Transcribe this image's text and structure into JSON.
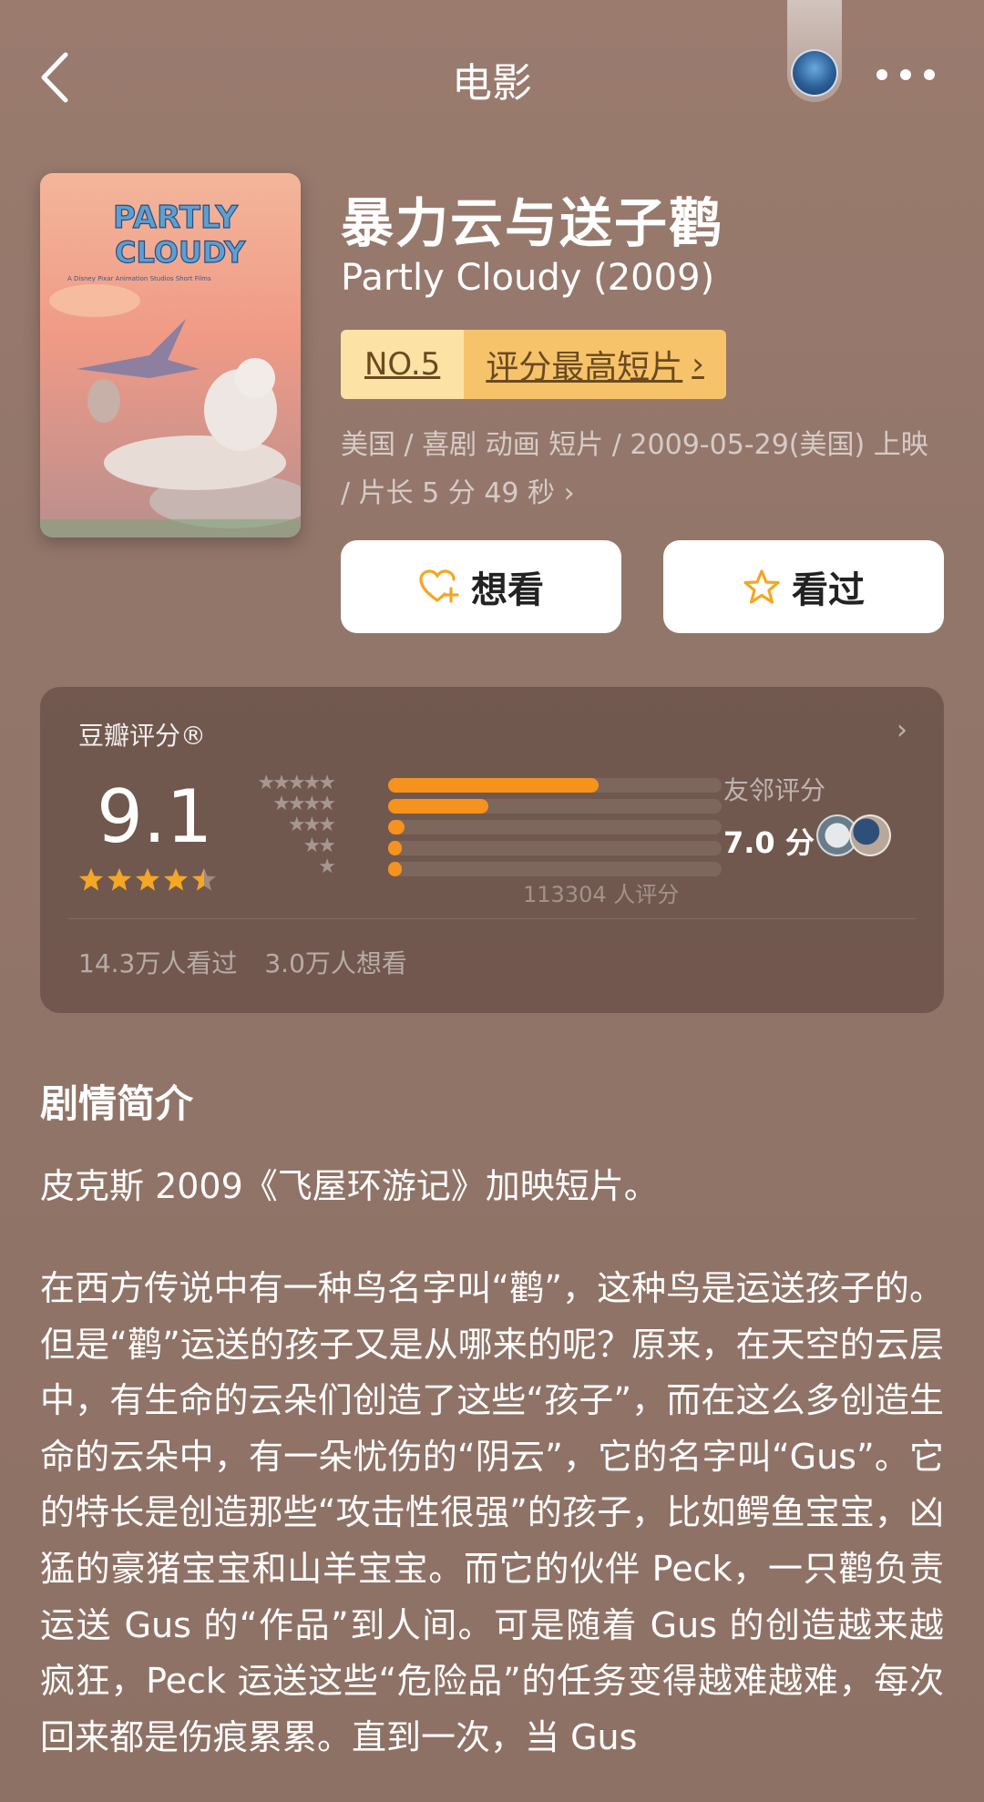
{
  "nav": {
    "title": "电影"
  },
  "movie": {
    "title_cn": "暴力云与送子鹳",
    "title_en": "Partly Cloudy (2009)",
    "rank_no": "NO.5",
    "rank_list": "评分最高短片",
    "meta": "美国 / 喜剧 动画 短片 / 2009-05-29(美国) 上映 / 片长 5 分 49 秒",
    "poster_text": {
      "line1": "PARTLY",
      "line2": "CLOUDY",
      "line3": "A Disney Pixar Animation Studios Short Films"
    }
  },
  "actions": {
    "want_label": "想看",
    "seen_label": "看过"
  },
  "rating": {
    "label": "豆瓣评分®",
    "score": "9.1",
    "stars_filled": 4.5,
    "histogram": [
      {
        "stars": "★★★★★",
        "pct": 63
      },
      {
        "stars": "★★★★",
        "pct": 30
      },
      {
        "stars": "★★★",
        "pct": 5
      },
      {
        "stars": "★★",
        "pct": 4
      },
      {
        "stars": "★",
        "pct": 4
      }
    ],
    "count_text": "113304 人评分",
    "friend_label": "友邻评分",
    "friend_score": "7.0 分",
    "seen_count": "14.3万人看过",
    "want_count": "3.0万人想看"
  },
  "synopsis": {
    "title": "剧情简介",
    "para1": "皮克斯 2009《飞屋环游记》加映短片。",
    "para2": "在西方传说中有一种鸟名字叫“鹳”，这种鸟是运送孩子的。但是“鹳”运送的孩子又是从哪来的呢？原来，在天空的云层中，有生命的云朵们创造了这些“孩子”，而在这么多创造生命的云朵中，有一朵忧伤的“阴云”，它的名字叫“Gus”。它的特长是创造那些“攻击性很强”的孩子，比如鳄鱼宝宝，凶猛的豪猪宝宝和山羊宝宝。而它的伙伴 Peck，一只鹳负责运送 Gus 的“作品”到人间。可是随着 Gus 的创造越来越疯狂，Peck 运送这些“危险品”的任务变得越难越难，每次回来都是伤痕累累。直到一次，当 Gus"
  },
  "colors": {
    "background": "#95786b",
    "accent_orange": "#f6921e",
    "star_gold": "#f5a623",
    "badge_light": "#fde2a6",
    "badge_dark": "#f7c36a"
  }
}
